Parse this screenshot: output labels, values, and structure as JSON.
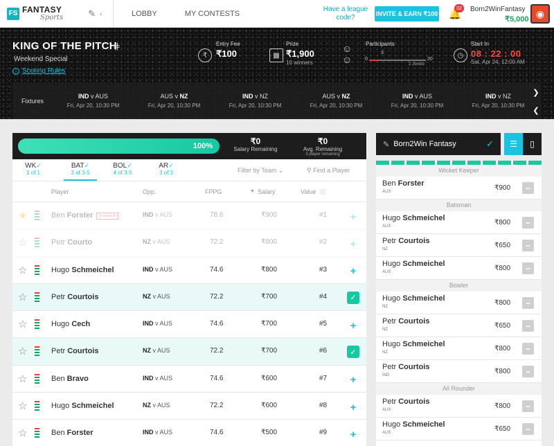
{
  "header": {
    "logo_main": "FANTASY",
    "logo_sub": "Sports",
    "nav": [
      {
        "label": "LOBBY"
      },
      {
        "label": "MY CONTESTS"
      }
    ],
    "league_prompt": "Have a league code?",
    "invite_label": "INVITE & EARN ₹100",
    "notification_count": "02",
    "user_name": "Born2WinFantasy",
    "user_balance": "₹5,000",
    "icons": {
      "sport": "cricket-bat-icon",
      "bell": "bell-icon",
      "avatar": "tiger-avatar"
    }
  },
  "contest": {
    "title": "KING OF THE PITCH",
    "subtitle": "Weekend Special",
    "rules_label": "Scoring Rules",
    "entry_fee_label": "Entry Fee",
    "entry_fee": "₹100",
    "prize_label": "Prize",
    "prize": "₹1,900",
    "prize_sub": "10 winners",
    "participants_label": "Participants",
    "participants_min": "0",
    "participants_current": "3",
    "participants_max": "20",
    "participants_joined": "2 Joined",
    "participants_fill": 0.15,
    "start_label": "Start In",
    "countdown": "08 : 22 : 00",
    "start_date": "Sat, Apr 24, 12:00 AM"
  },
  "fixtures": {
    "label": "Fixtures",
    "items": [
      {
        "home": "IND",
        "away": "AUS",
        "bold": "home",
        "date": "Fri, Apr 20, 10:30 PM"
      },
      {
        "home": "AUS",
        "away": "NZ",
        "bold": "away",
        "date": "Fri, Apr 20, 10:30 PM"
      },
      {
        "home": "IND",
        "away": "NZ",
        "bold": "home",
        "date": "Fri, Apr 20, 10:30 PM"
      },
      {
        "home": "AUS",
        "away": "NZ",
        "bold": "away",
        "date": "Fri, Apr 20, 10:30 PM"
      },
      {
        "home": "IND",
        "away": "AUS",
        "bold": "home",
        "date": "Fri, Apr 20, 10:30 PM"
      },
      {
        "home": "IND",
        "away": "NZ",
        "bold": "home",
        "date": "Fri, Apr 20, 10:30 PM"
      }
    ]
  },
  "picker": {
    "progress_label": "100%",
    "progress_fill": 1.0,
    "salary_remaining": "₹0",
    "salary_remaining_label": "Salary Remaining",
    "avg_remaining": "₹0",
    "avg_remaining_label": "Avg. Remaining",
    "avg_remaining_sub": "3 player remaining",
    "tabs": [
      {
        "name": "WK",
        "count": "1 of 1",
        "active": false
      },
      {
        "name": "BAT",
        "count": "3 of 3-5",
        "active": true
      },
      {
        "name": "BOL",
        "count": "4 of 3-5",
        "active": false
      },
      {
        "name": "AR",
        "count": "3 of 3",
        "active": false
      }
    ],
    "filter_label": "Filter by Team",
    "find_placeholder": "Find a Player",
    "columns": {
      "player": "Player",
      "opp": "Opp.",
      "fppg": "FPPG",
      "salary": "Salary",
      "value": "Value"
    },
    "rows": [
      {
        "first": "Ben",
        "last": "Forster",
        "tag": "Unavailable",
        "team": "IND",
        "vs": "AUS",
        "fppg": "78.6",
        "salary": "₹900",
        "value": "#1",
        "state": "dim",
        "fav": true
      },
      {
        "first": "Petr",
        "last": "Courto",
        "team": "NZ",
        "vs": "AUS",
        "fppg": "72.2",
        "salary": "₹800",
        "value": "#2",
        "state": "dim",
        "fav": false
      },
      {
        "first": "Hugo",
        "last": "Schmeichel",
        "team": "IND",
        "vs": "AUS",
        "fppg": "74.6",
        "salary": "₹800",
        "value": "#3",
        "state": "add",
        "fav": false
      },
      {
        "first": "Petr",
        "last": "Courtois",
        "team": "NZ",
        "vs": "AUS",
        "fppg": "72.2",
        "salary": "₹700",
        "value": "#4",
        "state": "sel",
        "fav": false
      },
      {
        "first": "Hugo",
        "last": "Cech",
        "team": "IND",
        "vs": "AUS",
        "fppg": "74.6",
        "salary": "₹700",
        "value": "#5",
        "state": "add",
        "fav": false
      },
      {
        "first": "Petr",
        "last": "Courtois",
        "team": "NZ",
        "vs": "AUS",
        "fppg": "72.2",
        "salary": "₹700",
        "value": "#6",
        "state": "sel",
        "fav": false
      },
      {
        "first": "Ben",
        "last": "Bravo",
        "team": "IND",
        "vs": "AUS",
        "fppg": "74.6",
        "salary": "₹600",
        "value": "#7",
        "state": "add",
        "fav": false
      },
      {
        "first": "Hugo",
        "last": "Schmeichel",
        "team": "NZ",
        "vs": "AUS",
        "fppg": "72.2",
        "salary": "₹600",
        "value": "#8",
        "state": "add",
        "fav": false
      },
      {
        "first": "Ben",
        "last": "Forster",
        "team": "IND",
        "vs": "AUS",
        "fppg": "74.6",
        "salary": "₹500",
        "value": "#9",
        "state": "add",
        "fav": false
      }
    ]
  },
  "team": {
    "name": "Born2Win Fantasy",
    "progress_segments": 11,
    "sections": [
      {
        "title": "Wicket Keeper",
        "players": [
          {
            "first": "Ben",
            "last": "Forster",
            "team": "AUS",
            "salary": "₹900"
          }
        ]
      },
      {
        "title": "Batsman",
        "players": [
          {
            "first": "Hugo",
            "last": "Schmeichel",
            "team": "AUS",
            "salary": "₹800"
          },
          {
            "first": "Petr",
            "last": "Courtois",
            "team": "NZ",
            "salary": "₹650"
          },
          {
            "first": "Hugo",
            "last": "Schmeichel",
            "team": "AUS",
            "salary": "₹800"
          }
        ]
      },
      {
        "title": "Bowler",
        "players": [
          {
            "first": "Hugo",
            "last": "Schmeichel",
            "team": "NZ",
            "salary": "₹800"
          },
          {
            "first": "Petr",
            "last": "Courtois",
            "team": "NZ",
            "salary": "₹650"
          },
          {
            "first": "Hugo",
            "last": "Schmeichel",
            "team": "NZ",
            "salary": "₹800"
          },
          {
            "first": "Petr",
            "last": "Courtois",
            "team": "IND",
            "salary": "₹800"
          }
        ]
      },
      {
        "title": "All Rounder",
        "players": [
          {
            "first": "Petr",
            "last": "Courtois",
            "team": "AUS",
            "salary": "₹800"
          },
          {
            "first": "Hugo",
            "last": "Schmeichel",
            "team": "AUS",
            "salary": "₹650"
          }
        ]
      }
    ]
  }
}
